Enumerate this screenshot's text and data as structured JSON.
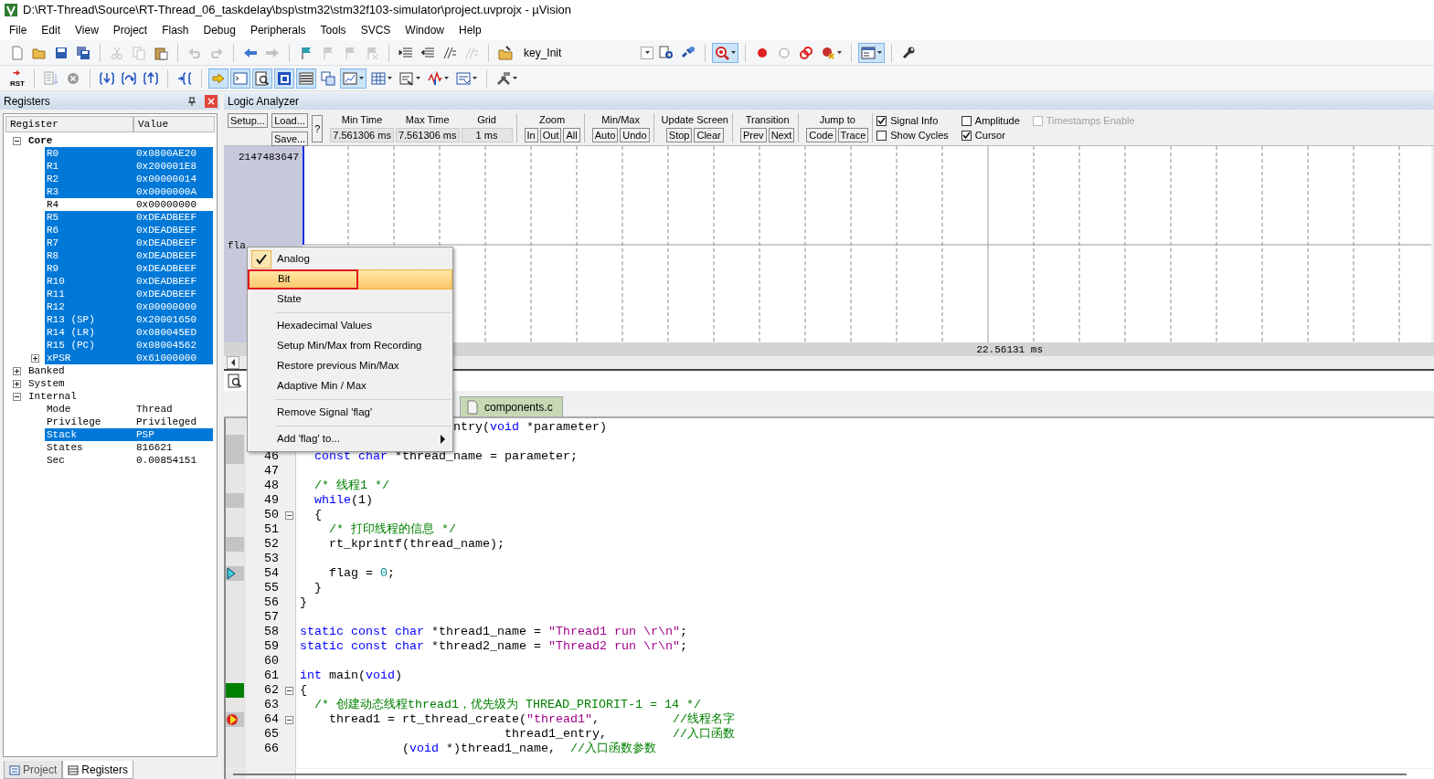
{
  "window": {
    "title": "D:\\RT-Thread\\Source\\RT-Thread_06_taskdelay\\bsp\\stm32\\stm32f103-simulator\\project.uvprojx - µVision"
  },
  "menu": [
    "File",
    "Edit",
    "View",
    "Project",
    "Flash",
    "Debug",
    "Peripherals",
    "Tools",
    "SVCS",
    "Window",
    "Help"
  ],
  "toolbar_1": {
    "target": "key_Init",
    "buttons": [
      {
        "pressed": false,
        "disabled": false
      },
      {
        "pressed": false,
        "disabled": false
      },
      {
        "pressed": false,
        "disabled": false
      },
      {
        "pressed": false,
        "disabled": false
      },
      {
        "pressed": false,
        "disabled": true
      },
      {
        "pressed": false,
        "disabled": true
      },
      {
        "pressed": false,
        "disabled": false
      },
      {
        "pressed": false,
        "disabled": true
      },
      {
        "pressed": false,
        "disabled": true
      },
      {
        "pressed": false,
        "disabled": false
      },
      {
        "pressed": false,
        "disabled": true
      },
      {
        "pressed": false,
        "disabled": false
      },
      {
        "pressed": false,
        "disabled": true
      },
      {
        "pressed": false,
        "disabled": true
      },
      {
        "pressed": false,
        "disabled": true
      },
      {
        "pressed": false,
        "disabled": false
      },
      {
        "pressed": false,
        "disabled": false
      },
      {
        "pressed": false,
        "disabled": false
      },
      {
        "pressed": false,
        "disabled": true
      },
      {
        "pressed": false,
        "disabled": false
      },
      {
        "pressed": false,
        "disabled": false
      },
      {
        "pressed": false,
        "disabled": false
      },
      {
        "pressed": true,
        "disabled": false
      },
      {
        "pressed": false,
        "disabled": false
      },
      {
        "pressed": false,
        "disabled": false
      },
      {
        "pressed": false,
        "disabled": false
      },
      {
        "pressed": false,
        "disabled": false
      },
      {
        "pressed": true,
        "disabled": false
      },
      {
        "pressed": false,
        "disabled": false
      }
    ]
  },
  "toolbar_2": {
    "reset_label": "RST",
    "buttons": [
      {
        "pressed": false,
        "disabled": false
      },
      {
        "pressed": false,
        "disabled": true
      },
      {
        "pressed": false,
        "disabled": false
      },
      {
        "pressed": false,
        "disabled": false
      },
      {
        "pressed": false,
        "disabled": false
      },
      {
        "pressed": false,
        "disabled": false
      },
      {
        "pressed": false,
        "disabled": false
      },
      {
        "pressed": true,
        "disabled": false
      },
      {
        "pressed": true,
        "disabled": false
      },
      {
        "pressed": true,
        "disabled": false
      },
      {
        "pressed": true,
        "disabled": false
      },
      {
        "pressed": true,
        "disabled": false
      },
      {
        "pressed": false,
        "disabled": false
      },
      {
        "pressed": true,
        "disabled": false
      },
      {
        "pressed": false,
        "disabled": false
      },
      {
        "pressed": false,
        "disabled": false
      },
      {
        "pressed": false,
        "disabled": false
      },
      {
        "pressed": false,
        "disabled": false
      },
      {
        "pressed": false,
        "disabled": false
      }
    ]
  },
  "registers": {
    "title": "Registers",
    "columns": [
      "Register",
      "Value"
    ],
    "tree": [
      {
        "name": "Core",
        "expanded": true,
        "selected": false,
        "children": [
          {
            "name": "R0",
            "value": "0x0800AE20",
            "selected": true
          },
          {
            "name": "R1",
            "value": "0x200001E8",
            "selected": true
          },
          {
            "name": "R2",
            "value": "0x00000014",
            "selected": true
          },
          {
            "name": "R3",
            "value": "0x0000000A",
            "selected": true
          },
          {
            "name": "R4",
            "value": "0x00000000",
            "selected": false
          },
          {
            "name": "R5",
            "value": "0xDEADBEEF",
            "selected": true
          },
          {
            "name": "R6",
            "value": "0xDEADBEEF",
            "selected": true
          },
          {
            "name": "R7",
            "value": "0xDEADBEEF",
            "selected": true
          },
          {
            "name": "R8",
            "value": "0xDEADBEEF",
            "selected": true
          },
          {
            "name": "R9",
            "value": "0xDEADBEEF",
            "selected": true
          },
          {
            "name": "R10",
            "value": "0xDEADBEEF",
            "selected": true
          },
          {
            "name": "R11",
            "value": "0xDEADBEEF",
            "selected": true
          },
          {
            "name": "R12",
            "value": "0x00000000",
            "selected": true
          },
          {
            "name": "R13 (SP)",
            "value": "0x20001650",
            "selected": true
          },
          {
            "name": "R14 (LR)",
            "value": "0x080045ED",
            "selected": true
          },
          {
            "name": "R15 (PC)",
            "value": "0x08004562",
            "selected": true
          },
          {
            "name": "xPSR",
            "value": "0x61000000",
            "selected": true,
            "expanded": false
          }
        ]
      },
      {
        "name": "Banked",
        "expanded": false,
        "selected": false
      },
      {
        "name": "System",
        "expanded": false,
        "selected": false
      },
      {
        "name": "Internal",
        "expanded": true,
        "selected": false,
        "children": [
          {
            "name": "Mode",
            "value": "Thread",
            "selected": false
          },
          {
            "name": "Privilege",
            "value": "Privileged",
            "selected": false
          },
          {
            "name": "Stack",
            "value": "PSP",
            "selected": true
          },
          {
            "name": "States",
            "value": "816621",
            "selected": false
          },
          {
            "name": "Sec",
            "value": "0.00854151",
            "selected": false
          }
        ]
      }
    ]
  },
  "panel_tabs": [
    {
      "label": "Project",
      "selected": false
    },
    {
      "label": "Registers",
      "selected": true
    }
  ],
  "logic_analyzer": {
    "title": "Logic Analyzer",
    "setup": "Setup...",
    "load": "Load...",
    "save": "Save...",
    "help": "?",
    "readouts": [
      {
        "label": "Min Time",
        "value": "7.561306 ms"
      },
      {
        "label": "Max Time",
        "value": "7.561306 ms"
      },
      {
        "label": "Grid",
        "value": "1 ms"
      }
    ],
    "groups": [
      {
        "label": "Zoom",
        "buttons": [
          "In",
          "Out",
          "All"
        ]
      },
      {
        "label": "Min/Max",
        "buttons": [
          "Auto",
          "Undo"
        ]
      },
      {
        "label": "Update Screen",
        "buttons": [
          "Stop",
          "Clear"
        ]
      },
      {
        "label": "Transition",
        "buttons": [
          "Prev",
          "Next"
        ]
      },
      {
        "label": "Jump to",
        "buttons": [
          "Code",
          "Trace"
        ]
      }
    ],
    "options": [
      {
        "label": "Signal Info",
        "checked": true,
        "disabled": false
      },
      {
        "label": "Show Cycles",
        "checked": false,
        "disabled": false
      },
      {
        "label": "Amplitude",
        "checked": false,
        "disabled": false
      },
      {
        "label": "Cursor",
        "checked": true,
        "disabled": false
      },
      {
        "label": "Timestamps Enable",
        "checked": false,
        "disabled": true
      }
    ],
    "axis_max": "2147483647",
    "signal": "fla",
    "cursor_time": "22.56131 ms"
  },
  "context_menu": [
    {
      "kind": "option",
      "label": "Analog",
      "checked": true,
      "selected": false,
      "annotated": false
    },
    {
      "kind": "option",
      "label": "Bit",
      "checked": false,
      "selected": true,
      "annotated": true
    },
    {
      "kind": "option",
      "label": "State",
      "checked": false,
      "selected": false,
      "annotated": false
    },
    {
      "kind": "separator"
    },
    {
      "kind": "item",
      "label": "Hexadecimal Values",
      "checked": false,
      "selected": false,
      "annotated": false
    },
    {
      "kind": "item",
      "label": "Setup Min/Max from Recording",
      "checked": false,
      "selected": false,
      "annotated": false
    },
    {
      "kind": "item",
      "label": "Restore previous Min/Max",
      "checked": false,
      "selected": false,
      "annotated": false
    },
    {
      "kind": "item",
      "label": "Adaptive Min / Max",
      "checked": false,
      "selected": false,
      "annotated": false
    },
    {
      "kind": "separator"
    },
    {
      "kind": "item",
      "label": "Remove Signal 'flag'",
      "checked": false,
      "selected": false,
      "annotated": false
    },
    {
      "kind": "separator"
    },
    {
      "kind": "submenu",
      "label": "Add 'flag' to...",
      "checked": false,
      "selected": false,
      "annotated": false
    }
  ],
  "editor": {
    "tabs": [
      {
        "label": "components.c",
        "selected": false
      }
    ],
    "lines": [
      {
        "code": [
          {
            "kind": "plain",
            "text": "                     ntry("
          },
          {
            "kind": "keyword",
            "text": "void"
          },
          {
            "kind": "plain",
            "text": " *parameter)"
          }
        ]
      },
      {
        "marker": {
          "kind": "code"
        }
      },
      {
        "number": "46",
        "marker": {
          "kind": "code"
        },
        "code": [
          {
            "kind": "keyword",
            "text": "  const"
          },
          {
            "kind": "keyword",
            "text": " char"
          },
          {
            "kind": "plain",
            "text": " *thread_name = parameter;"
          }
        ]
      },
      {
        "number": "47"
      },
      {
        "number": "48",
        "code": [
          {
            "kind": "comment",
            "text": "  /* 线程1 */"
          }
        ]
      },
      {
        "number": "49",
        "marker": {
          "kind": "code"
        },
        "code": [
          {
            "kind": "keyword",
            "text": "  while"
          },
          {
            "kind": "plain",
            "text": "(1)"
          }
        ]
      },
      {
        "number": "50",
        "fold": true,
        "code": [
          {
            "kind": "plain",
            "text": "  {"
          }
        ]
      },
      {
        "number": "51",
        "code": [
          {
            "kind": "comment",
            "text": "    /* 打印线程的信息 */"
          }
        ]
      },
      {
        "number": "52",
        "marker": {
          "kind": "code"
        },
        "code": [
          {
            "kind": "plain",
            "text": "    rt_kprintf(thread_name);"
          }
        ]
      },
      {
        "number": "53"
      },
      {
        "number": "54",
        "marker": {
          "kind": "current"
        },
        "code": [
          {
            "kind": "plain",
            "text": "    flag = "
          },
          {
            "kind": "number",
            "text": "0"
          },
          {
            "kind": "plain",
            "text": ";"
          }
        ]
      },
      {
        "number": "55",
        "code": [
          {
            "kind": "plain",
            "text": "  }"
          }
        ]
      },
      {
        "number": "56",
        "code": [
          {
            "kind": "plain",
            "text": "}"
          }
        ]
      },
      {
        "number": "57"
      },
      {
        "number": "58",
        "code": [
          {
            "kind": "keyword",
            "text": "static"
          },
          {
            "kind": "keyword",
            "text": " const"
          },
          {
            "kind": "keyword",
            "text": " char"
          },
          {
            "kind": "plain",
            "text": " *thread1_name = "
          },
          {
            "kind": "string",
            "text": "\"Thread1 run \\r\\n\""
          },
          {
            "kind": "plain",
            "text": ";"
          }
        ]
      },
      {
        "number": "59",
        "code": [
          {
            "kind": "keyword",
            "text": "static"
          },
          {
            "kind": "keyword",
            "text": " const"
          },
          {
            "kind": "keyword",
            "text": " char"
          },
          {
            "kind": "plain",
            "text": " *thread2_name = "
          },
          {
            "kind": "string",
            "text": "\"Thread2 run \\r\\n\""
          },
          {
            "kind": "plain",
            "text": ";"
          }
        ]
      },
      {
        "number": "60"
      },
      {
        "number": "61",
        "code": [
          {
            "kind": "keyword",
            "text": "int"
          },
          {
            "kind": "plain",
            "text": " main("
          },
          {
            "kind": "keyword",
            "text": "void"
          },
          {
            "kind": "plain",
            "text": ")"
          }
        ]
      },
      {
        "number": "62",
        "fold": true,
        "marker": {
          "kind": "executed"
        },
        "code": [
          {
            "kind": "plain",
            "text": "{"
          }
        ]
      },
      {
        "number": "63",
        "code": [
          {
            "kind": "comment",
            "text": "  /* 创建动态线程thread1，优先级为 THREAD_PRIORIT-1 = 14 */"
          }
        ]
      },
      {
        "number": "64",
        "fold": true,
        "marker": {
          "kind": "breakpoint"
        },
        "code": [
          {
            "kind": "plain",
            "text": "    thread1 = rt_thread_create("
          },
          {
            "kind": "string",
            "text": "\"thread1\""
          },
          {
            "kind": "plain",
            "text": ",          "
          },
          {
            "kind": "comment",
            "text": "//线程名字"
          }
        ]
      },
      {
        "number": "65",
        "code": [
          {
            "kind": "plain",
            "text": "                            thread1_entry,         "
          },
          {
            "kind": "comment",
            "text": "//入口函数"
          }
        ]
      },
      {
        "number": "66",
        "code": [
          {
            "kind": "plain",
            "text": "              ("
          },
          {
            "kind": "keyword",
            "text": "void"
          },
          {
            "kind": "plain",
            "text": " *)thread1_name,  "
          },
          {
            "kind": "comment",
            "text": "//入口函数参数"
          }
        ]
      }
    ]
  }
}
